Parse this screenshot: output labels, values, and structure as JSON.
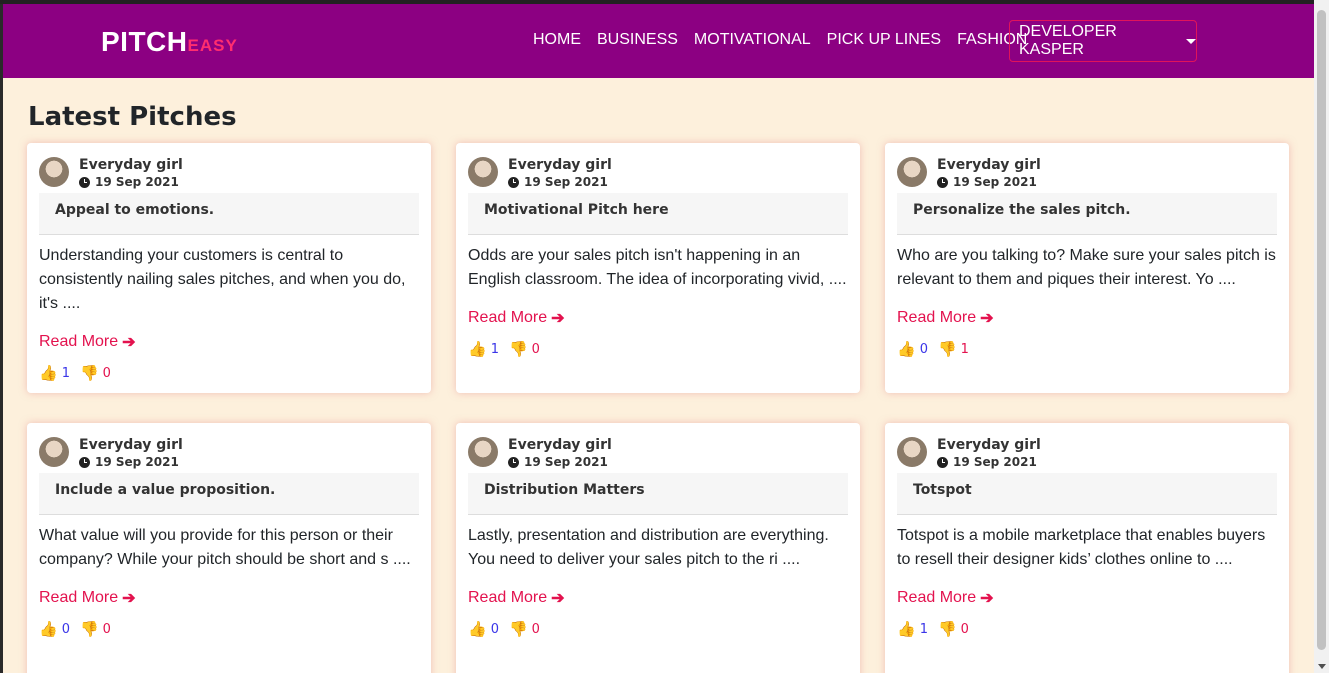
{
  "brand": {
    "main": "PITCH",
    "sub": "EASY"
  },
  "nav": {
    "links": [
      "HOME",
      "BUSINESS",
      "MOTIVATIONAL",
      "PICK UP LINES",
      "FASHION"
    ],
    "user_dropdown": "DEVELOPER KASPER"
  },
  "heading": "Latest Pitches",
  "read_more": "Read More",
  "cards": [
    {
      "author": "Everyday girl",
      "date": "19 Sep 2021",
      "title": "Appeal to emotions.",
      "body": "Understanding your customers is central to consistently nailing sales pitches, and when you do, it's ....",
      "upvotes": "1",
      "downvotes": "0"
    },
    {
      "author": "Everyday girl",
      "date": "19 Sep 2021",
      "title": "Motivational Pitch here",
      "body": "Odds are your sales pitch isn't happening in an English classroom. The idea of incorporating vivid, ....",
      "upvotes": "1",
      "downvotes": "0"
    },
    {
      "author": "Everyday girl",
      "date": "19 Sep 2021",
      "title": "Personalize the sales pitch.",
      "body": "Who are you talking to? Make sure your sales pitch is relevant to them and piques their interest. Yo ....",
      "upvotes": "0",
      "downvotes": "1"
    },
    {
      "author": "Everyday girl",
      "date": "19 Sep 2021",
      "title": "Include a value proposition.",
      "body": "What value will you provide for this person or their company? While your pitch should be short and s ....",
      "upvotes": "0",
      "downvotes": "0"
    },
    {
      "author": "Everyday girl",
      "date": "19 Sep 2021",
      "title": "Distribution Matters",
      "body": "Lastly, presentation and distribution are everything. You need to deliver your sales pitch to the ri ....",
      "upvotes": "0",
      "downvotes": "0"
    },
    {
      "author": "Everyday girl",
      "date": "19 Sep 2021",
      "title": "Totspot",
      "body": "Totspot is a mobile marketplace that enables buyers to resell their designer kids’ clothes online to ....",
      "upvotes": "1",
      "downvotes": "0"
    }
  ],
  "colors": {
    "navbar": "#8c0082",
    "accent": "#e3124e",
    "upvote": "#3a35e8",
    "background": "#fdf0dc"
  }
}
